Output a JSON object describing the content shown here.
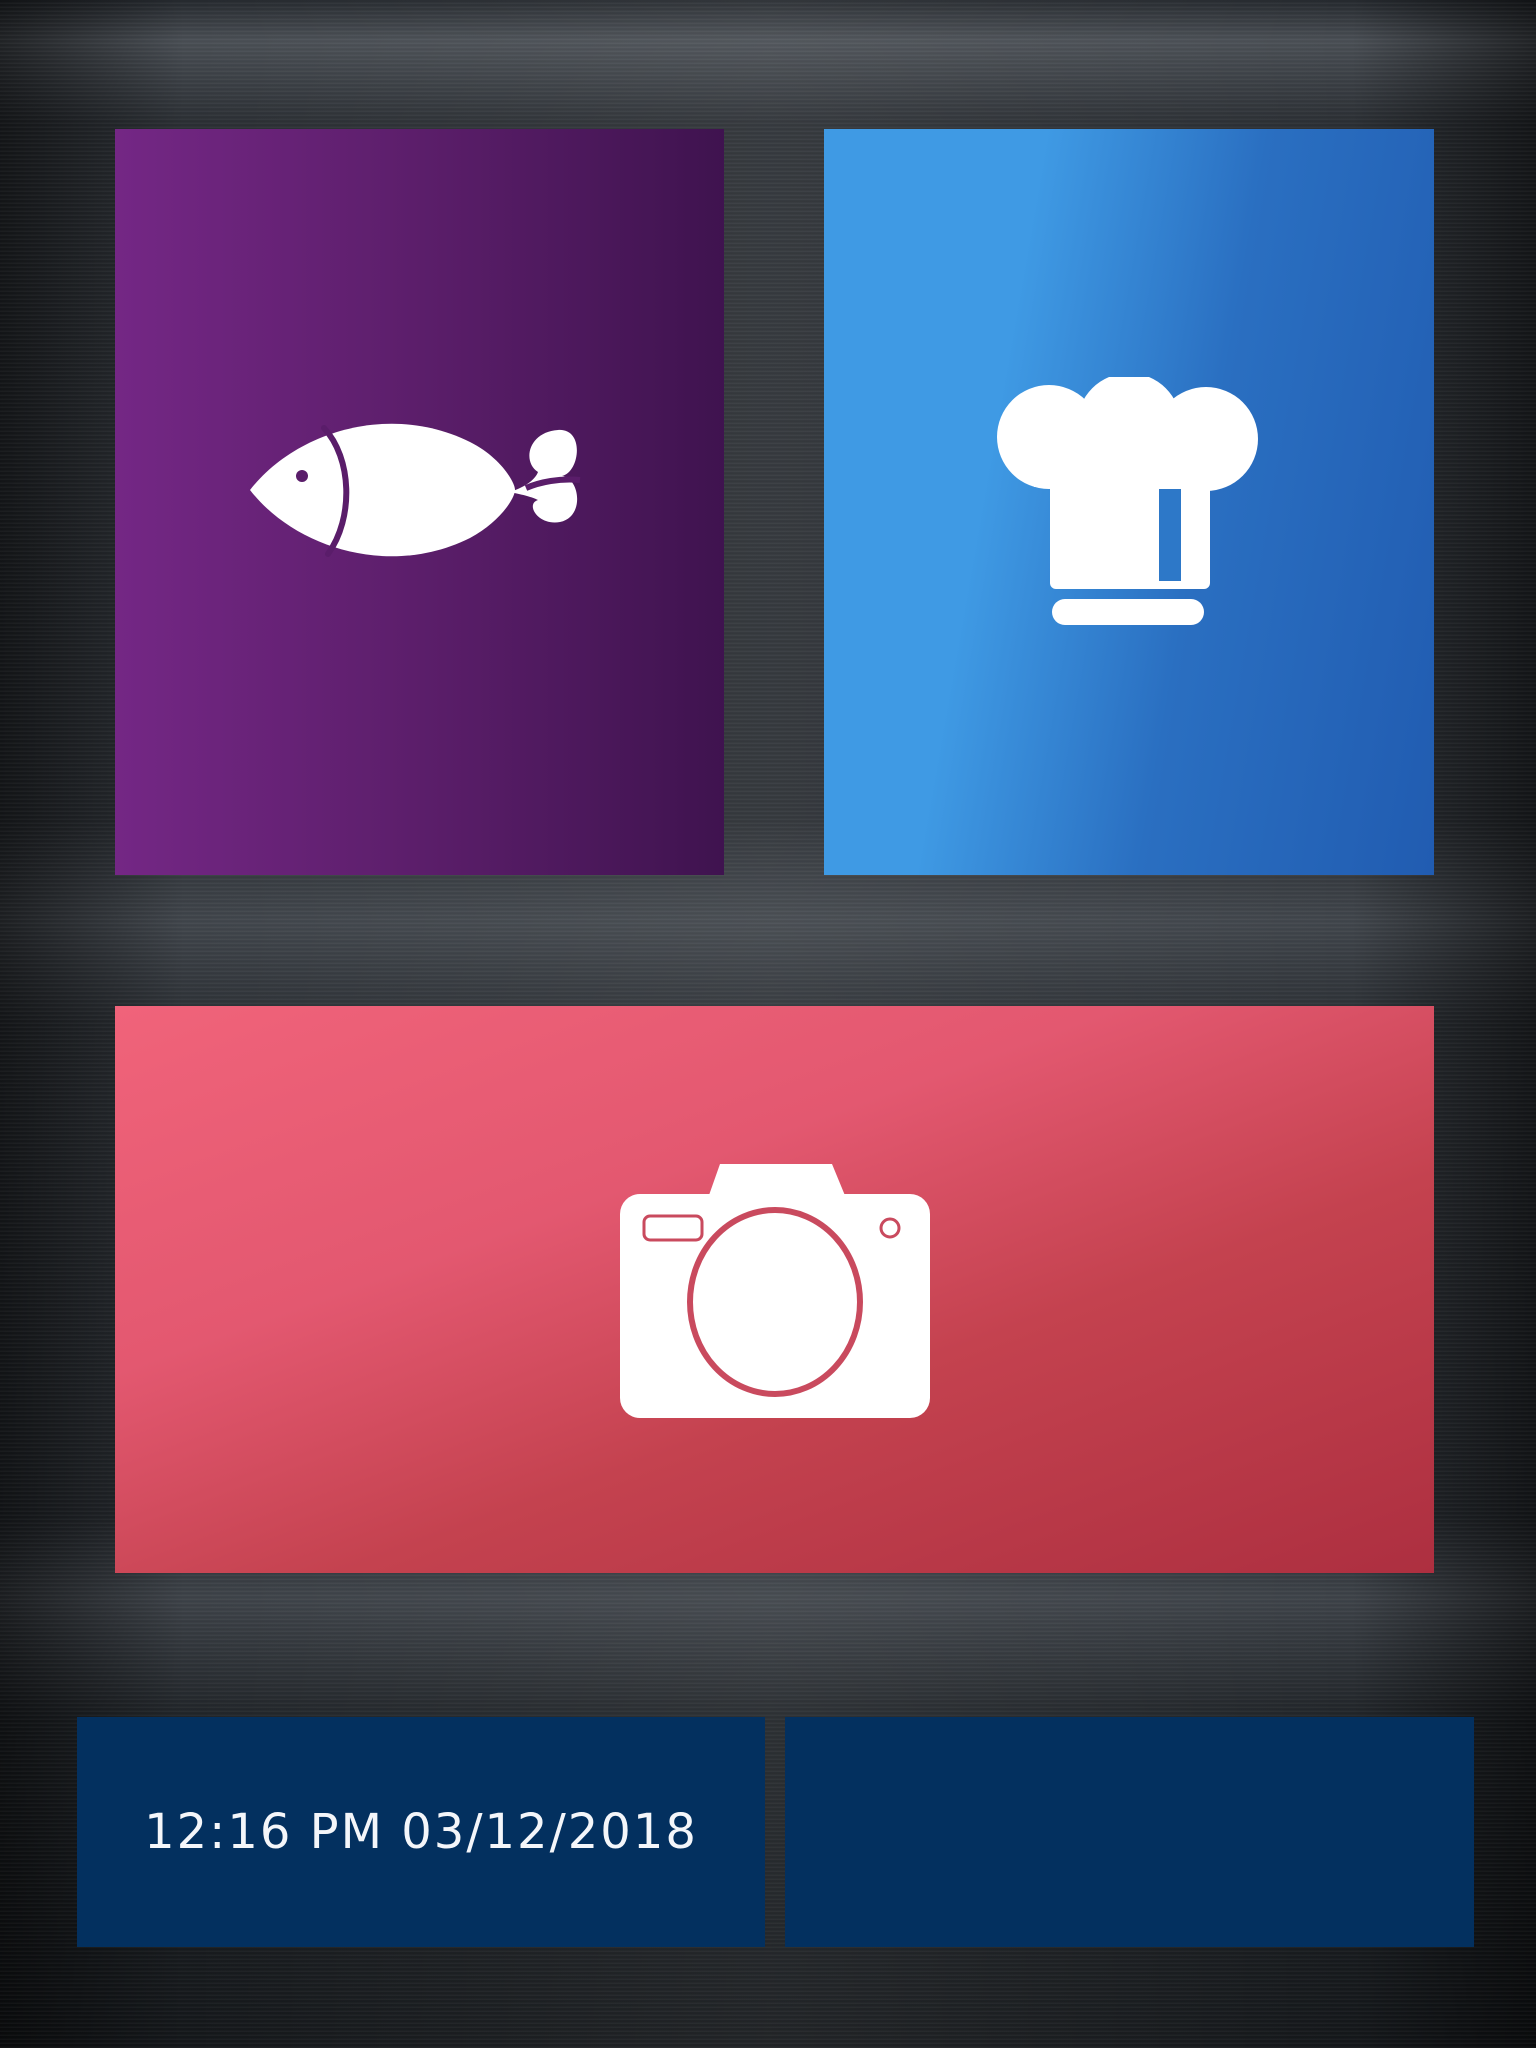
{
  "tiles": {
    "fish": {
      "icon": "fish-icon",
      "color_from": "#742785",
      "color_to": "#3f134f"
    },
    "chef": {
      "icon": "chef-hat-icon",
      "color_from": "#3f9ae4",
      "color_to": "#215cb1"
    },
    "camera": {
      "icon": "camera-icon",
      "color_from": "#f0637a",
      "color_to": "#ad2f40"
    }
  },
  "status_bar": {
    "datetime": "12:16 PM 03/12/2018",
    "background": "#03305f",
    "right_panel_text": ""
  }
}
